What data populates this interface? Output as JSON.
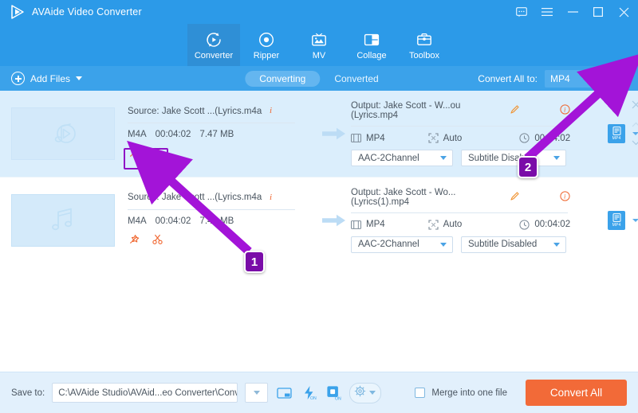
{
  "titlebar": {
    "app_name": "AVAide Video Converter",
    "controls": [
      {
        "name": "feedback-icon",
        "label": "Feedback"
      },
      {
        "name": "menu-icon",
        "label": "Menu"
      },
      {
        "name": "minimize-icon",
        "label": "Minimize"
      },
      {
        "name": "maximize-icon",
        "label": "Maximize"
      },
      {
        "name": "close-icon",
        "label": "Close"
      }
    ]
  },
  "nav": {
    "tabs": [
      {
        "label": "Converter",
        "icon": "converter-icon",
        "active": true
      },
      {
        "label": "Ripper",
        "icon": "ripper-icon",
        "active": false
      },
      {
        "label": "MV",
        "icon": "mv-icon",
        "active": false
      },
      {
        "label": "Collage",
        "icon": "collage-icon",
        "active": false
      },
      {
        "label": "Toolbox",
        "icon": "toolbox-icon",
        "active": false
      }
    ]
  },
  "toolbar": {
    "add_files_label": "Add Files",
    "segment": [
      {
        "label": "Converting",
        "active": true
      },
      {
        "label": "Converted",
        "active": false
      }
    ],
    "convert_all_to_label": "Convert All to:",
    "convert_all_to_value": "MP4"
  },
  "files": [
    {
      "selected": true,
      "thumb_icon": "music-note-play-icon",
      "source_label": "Source: Jake Scott ...(Lyrics.m4a",
      "source_format": "M4A",
      "source_duration": "00:04:02",
      "source_size": "7.47 MB",
      "actions": [
        {
          "name": "enhance-wand-icon",
          "label": "Edit"
        },
        {
          "name": "scissors-trim-icon",
          "label": "Trim"
        }
      ],
      "output_label": "Output: Jake Scott - W...ou (Lyrics.mp4",
      "output_format": "MP4",
      "output_resolution": "Auto",
      "output_duration": "00:04:02",
      "audio_select": "AAC-2Channel",
      "subtitle_select": "Subtitle Disabled",
      "format_chip": "MP4"
    },
    {
      "selected": false,
      "thumb_icon": "music-note-icon",
      "source_label": "Source: Jake Scott ...(Lyrics.m4a",
      "source_format": "M4A",
      "source_duration": "00:04:02",
      "source_size": "7.47 MB",
      "actions": [
        {
          "name": "enhance-wand-icon",
          "label": "Edit"
        },
        {
          "name": "scissors-trim-icon",
          "label": "Trim"
        }
      ],
      "output_label": "Output: Jake Scott - Wo... (Lyrics(1).mp4",
      "output_format": "MP4",
      "output_resolution": "Auto",
      "output_duration": "00:04:02",
      "audio_select": "AAC-2Channel",
      "subtitle_select": "Subtitle Disabled",
      "format_chip": "MP4"
    }
  ],
  "bottombar": {
    "save_to_label": "Save to:",
    "save_to_path": "C:\\AVAide Studio\\AVAid...eo Converter\\Converted",
    "merge_label": "Merge into one file",
    "merge_checked": false,
    "convert_all_label": "Convert All",
    "tool_icons": [
      {
        "name": "open-folder-icon"
      },
      {
        "name": "hardware-acceleration-on-icon",
        "state": "ON"
      },
      {
        "name": "gpu-acceleration-on-icon",
        "state": "ON"
      },
      {
        "name": "preferences-gear-icon"
      }
    ]
  },
  "annotations": {
    "badges": [
      {
        "id": "1",
        "label": "1"
      },
      {
        "id": "2",
        "label": "2"
      }
    ],
    "arrow_color": "#a314d8",
    "highlight_color": "#8f12c6"
  },
  "colors": {
    "brand_blue": "#2c9ae8",
    "toolbar_blue": "#3ba2ea",
    "row_selected": "#dbeefc",
    "accent_orange": "#f26a38",
    "annotation_purple": "#a314d8"
  }
}
